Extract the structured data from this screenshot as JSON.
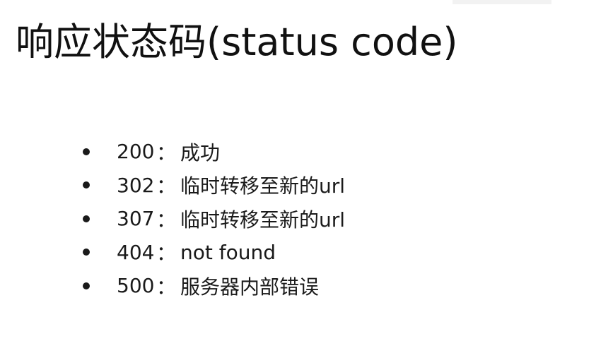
{
  "slide": {
    "title": "响应状态码(status code)",
    "items": [
      {
        "code": "200",
        "separator": "：",
        "description": "成功"
      },
      {
        "code": "302",
        "separator": "：",
        "description": "临时转移至新的url"
      },
      {
        "code": "307",
        "separator": "：",
        "description": "临时转移至新的url"
      },
      {
        "code": "404",
        "separator": "：",
        "description": "not found"
      },
      {
        "code": "500",
        "separator": "：",
        "description": "服务器内部错误"
      }
    ]
  }
}
